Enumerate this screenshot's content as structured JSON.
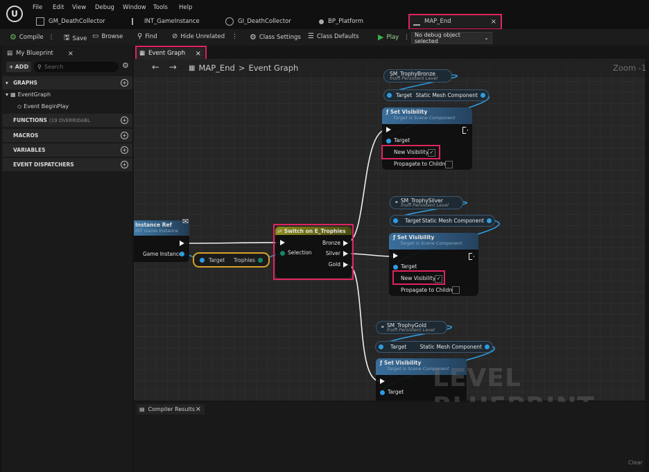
{
  "menu": [
    "File",
    "Edit",
    "View",
    "Debug",
    "Window",
    "Tools",
    "Help"
  ],
  "tabs": [
    {
      "label": "GM_DeathCollector"
    },
    {
      "label": "INT_GameInstance"
    },
    {
      "label": "GI_DeathCollector"
    },
    {
      "label": "BP_Platform"
    },
    {
      "label": "MAP_End",
      "close": "×"
    }
  ],
  "toolbar": {
    "compile": "Compile",
    "save": "Save",
    "browse": "Browse",
    "find": "Find",
    "hide_unrelated": "Hide Unrelated",
    "class_settings": "Class Settings",
    "class_defaults": "Class Defaults",
    "play": "Play",
    "debug_select": "No debug object selected"
  },
  "left_panel": {
    "tab": "My Blueprint",
    "close": "×",
    "add": "ADD",
    "search_placeholder": "Search",
    "graphs": "GRAPHS",
    "event_graph": "EventGraph",
    "event_begin": "Event BeginPlay",
    "functions": "FUNCTIONS",
    "functions_count": "(19 OVERRIDABL",
    "macros": "MACROS",
    "variables": "VARIABLES",
    "dispatchers": "EVENT DISPATCHERS"
  },
  "graph_tab": {
    "label": "Event Graph",
    "close": "×"
  },
  "breadcrumb": {
    "root": "MAP_End",
    "sep": ">",
    "current": "Event Graph",
    "zoom": "Zoom -1"
  },
  "nodes": {
    "instance_ref": {
      "title": "Instance Ref",
      "subtitle": "INT Game Instance",
      "pin": "Game Instance"
    },
    "trophies_get": {
      "target": "Target",
      "value": "Trophies"
    },
    "switch": {
      "title": "Switch on E_Trophies",
      "selection": "Selection",
      "out": [
        "Bronze",
        "Silver",
        "Gold"
      ]
    },
    "bronze": {
      "var": "SM_TrophyBronze",
      "var_sub": "from Persistent Level",
      "target": "Target",
      "comp": "Static Mesh Component",
      "title": "Set Visibility",
      "sub": "Target is Scene Component",
      "target_pin": "Target",
      "new_vis": "New Visibility",
      "prop": "Propagate to Children"
    },
    "silver": {
      "var": "SM_TrophySilver",
      "var_sub": "from Persistent Level",
      "target": "Target",
      "comp": "Static Mesh Component",
      "title": "Set Visibility",
      "sub": "Target is Scene Component",
      "target_pin": "Target",
      "new_vis": "New Visibility",
      "prop": "Propagate to Children"
    },
    "gold": {
      "var": "SM_TrophyGold",
      "var_sub": "from Persistent Level",
      "target": "Target",
      "comp": "Static Mesh Component",
      "title": "Set Visibility",
      "sub": "Target is Scene Component",
      "target_pin": "Target"
    }
  },
  "watermark": "LEVEL BLUEPRINT",
  "compiler": {
    "tab": "Compiler Results",
    "close": "×",
    "clear": "Clear"
  },
  "colors": {
    "highlight": "#e0245e",
    "exec": "#f2f2f2",
    "object_pin": "#2f9be0",
    "play": "#36b24a"
  }
}
